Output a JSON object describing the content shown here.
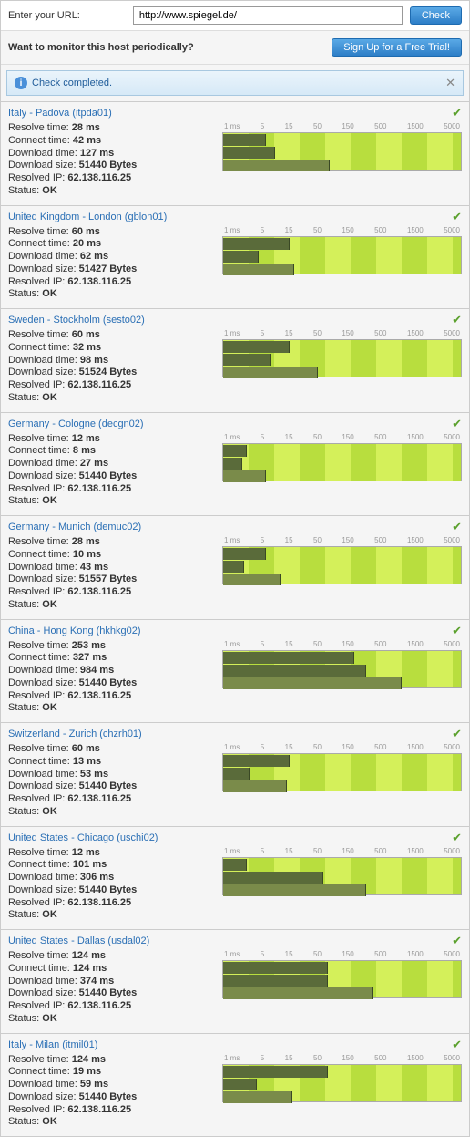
{
  "header": {
    "url_label": "Enter your URL:",
    "url_value": "http://www.spiegel.de/",
    "check_btn": "Check",
    "monitor_text": "Want to monitor this host periodically?",
    "signup_btn": "Sign Up for a Free Trial!",
    "status_text": "Check completed."
  },
  "ticks": [
    "1 ms",
    "5",
    "15",
    "50",
    "150",
    "500",
    "1500",
    "5000"
  ],
  "labels": {
    "resolve": "Resolve time: ",
    "connect": "Connect time: ",
    "download_time": "Download time: ",
    "download_size": "Download size: ",
    "resolved_ip": "Resolved IP: ",
    "status": "Status: ",
    "ms": " ms",
    "bytes": " Bytes"
  },
  "locations": [
    {
      "title": "Italy - Padova (itpda01)",
      "resolve": 28,
      "connect": 42,
      "download_time": 127,
      "download_size": 51440,
      "ip": "62.138.116.25",
      "status": "OK",
      "bars": [
        18,
        22,
        45
      ]
    },
    {
      "title": "United Kingdom - London (gblon01)",
      "resolve": 60,
      "connect": 20,
      "download_time": 62,
      "download_size": 51427,
      "ip": "62.138.116.25",
      "status": "OK",
      "bars": [
        28,
        15,
        30
      ]
    },
    {
      "title": "Sweden - Stockholm (sesto02)",
      "resolve": 60,
      "connect": 32,
      "download_time": 98,
      "download_size": 51524,
      "ip": "62.138.116.25",
      "status": "OK",
      "bars": [
        28,
        20,
        40
      ]
    },
    {
      "title": "Germany - Cologne (decgn02)",
      "resolve": 12,
      "connect": 8,
      "download_time": 27,
      "download_size": 51440,
      "ip": "62.138.116.25",
      "status": "OK",
      "bars": [
        10,
        8,
        18
      ]
    },
    {
      "title": "Germany - Munich (demuc02)",
      "resolve": 28,
      "connect": 10,
      "download_time": 43,
      "download_size": 51557,
      "ip": "62.138.116.25",
      "status": "OK",
      "bars": [
        18,
        9,
        24
      ]
    },
    {
      "title": "China - Hong Kong (hkhkg02)",
      "resolve": 253,
      "connect": 327,
      "download_time": 984,
      "download_size": 51440,
      "ip": "62.138.116.25",
      "status": "OK",
      "bars": [
        55,
        60,
        75
      ]
    },
    {
      "title": "Switzerland - Zurich (chzrh01)",
      "resolve": 60,
      "connect": 13,
      "download_time": 53,
      "download_size": 51440,
      "ip": "62.138.116.25",
      "status": "OK",
      "bars": [
        28,
        11,
        27
      ]
    },
    {
      "title": "United States - Chicago (uschi02)",
      "resolve": 12,
      "connect": 101,
      "download_time": 306,
      "download_size": 51440,
      "ip": "62.138.116.25",
      "status": "OK",
      "bars": [
        10,
        42,
        60
      ]
    },
    {
      "title": "United States - Dallas (usdal02)",
      "resolve": 124,
      "connect": 124,
      "download_time": 374,
      "download_size": 51440,
      "ip": "62.138.116.25",
      "status": "OK",
      "bars": [
        44,
        44,
        63
      ]
    },
    {
      "title": "Italy - Milan (itmil01)",
      "resolve": 124,
      "connect": 19,
      "download_time": 59,
      "download_size": 51440,
      "ip": "62.138.116.25",
      "status": "OK",
      "bars": [
        44,
        14,
        29
      ]
    }
  ]
}
